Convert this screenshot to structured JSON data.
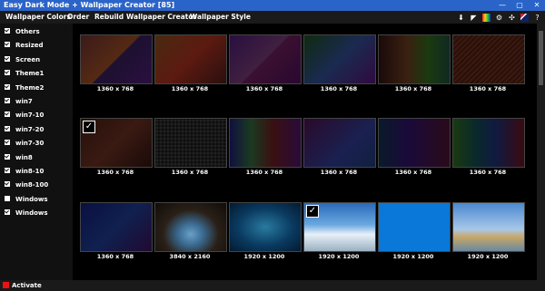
{
  "app": {
    "title": "Easy Dark Mode + Wallpaper Creator [85]",
    "win_buttons": [
      "—",
      "▢",
      "✕"
    ]
  },
  "menu": [
    "Wallpaper Colors",
    "Order",
    "Rebuild",
    "Wallpaper Creator",
    "Wallpaper Style"
  ],
  "toolbar_icons": [
    "download-icon",
    "cursor-icon",
    "palette-icon",
    "gear-icon",
    "gamepad-icon",
    "flag-icon",
    "help-icon"
  ],
  "sidebar": [
    {
      "label": "Others",
      "checked": true
    },
    {
      "label": "Resized",
      "checked": true
    },
    {
      "label": "Screen",
      "checked": true
    },
    {
      "label": "Theme1",
      "checked": true
    },
    {
      "label": "Theme2",
      "checked": true
    },
    {
      "label": "win7",
      "checked": true
    },
    {
      "label": "win7-10",
      "checked": true
    },
    {
      "label": "win7-20",
      "checked": true
    },
    {
      "label": "win7-30",
      "checked": true
    },
    {
      "label": "win8",
      "checked": true
    },
    {
      "label": "win8-10",
      "checked": true
    },
    {
      "label": "win8-100",
      "checked": true
    },
    {
      "label": "Windows",
      "checked": false
    },
    {
      "label": "Windows",
      "checked": true
    }
  ],
  "thumbnails": [
    {
      "label": "1360 x 768",
      "bg": "linear-gradient(135deg,#3a1a1a 0%,#552a14 49%,#1d1030 51%,#2a1040 100%)",
      "checked": false
    },
    {
      "label": "1360 x 768",
      "bg": "linear-gradient(135deg,#4a2a10 0%,#5c1a10 50%,#2a0f0f 100%)",
      "checked": false
    },
    {
      "label": "1360 x 768",
      "bg": "linear-gradient(135deg,#2a0f40 0%,#402040 49%,#3a1030 51%,#2a0830 100%)",
      "checked": false
    },
    {
      "label": "1360 x 768",
      "bg": "linear-gradient(135deg,#102a10 0%,#1a2a50 50%,#300a40 100%)",
      "checked": false
    },
    {
      "label": "1360 x 768",
      "bg": "linear-gradient(90deg,#1a0a0a 0%,#3a2010 40%,#1a3a10 70%,#102a20 100%)",
      "checked": false
    },
    {
      "label": "1360 x 768",
      "bg": "repeating-linear-gradient(135deg,#3a1a0f 0px,#3a1a0f 2px,#2a0f0a 2px,#2a0f0a 4px)",
      "checked": false
    },
    {
      "label": "1360 x 768",
      "bg": "linear-gradient(135deg,#25100a 0%,#3a1a12 50%,#1a0a08 100%)",
      "checked": true
    },
    {
      "label": "1360 x 768",
      "bg": "radial-gradient(#222 1px,#0d0d0d 2px) 0 0/4px 4px",
      "checked": false
    },
    {
      "label": "1360 x 768",
      "bg": "linear-gradient(90deg,#101040 0%,#1a3a20 30%,#3a1010 60%,#2a0a3a 100%)",
      "checked": false
    },
    {
      "label": "1360 x 768",
      "bg": "linear-gradient(135deg,#2a0a2a 0%,#1a2050 60%,#102040 100%)",
      "checked": false
    },
    {
      "label": "1360 x 768",
      "bg": "linear-gradient(90deg,#0a1a2a 0%,#1a0a3a 40%,#2a0a1a 100%)",
      "checked": false
    },
    {
      "label": "1360 x 768",
      "bg": "linear-gradient(90deg,#1a3a10 0%,#0a2a2a 30%,#101a40 60%,#3a0a10 100%)",
      "checked": false
    },
    {
      "label": "1360 x 768",
      "bg": "linear-gradient(135deg,#0a1040 0%,#102050 50%,#200a30 100%)",
      "checked": false
    },
    {
      "label": "3840 x 2160",
      "bg": "radial-gradient(ellipse at 50% 65%,#6aa0c8 0%,#3a6a90 25%,#2a2018 55%,#100c08 100%)",
      "checked": false
    },
    {
      "label": "1920 x 1200",
      "bg": "radial-gradient(ellipse at 50% 50%,#2a7aa0 0%,#0a3a60 55%,#041a30 100%)",
      "checked": false
    },
    {
      "label": "1920 x 1200",
      "bg": "linear-gradient(180deg,#2a6ab8 0%,#6aa8e0 45%,#e8f0f8 65%,#9ab0c0 100%)",
      "checked": true
    },
    {
      "label": "1920 x 1200",
      "bg": "#0a78d8",
      "checked": false
    },
    {
      "label": "1920 x 1200",
      "bg": "linear-gradient(180deg,#4a88d0 0%,#a8c8e8 55%,#c8a868 70%,#6a88a0 100%)",
      "checked": false
    }
  ]
}
